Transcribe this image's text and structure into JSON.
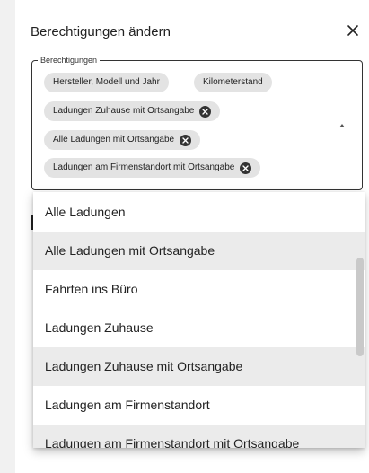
{
  "dialog": {
    "title": "Berechtigungen ändern",
    "close_icon": "close-icon"
  },
  "field": {
    "legend": "Berechtigungen",
    "chips": [
      {
        "label": "Hersteller, Modell und Jahr",
        "removable": false
      },
      {
        "label": "Kilometerstand",
        "removable": false
      },
      {
        "label": "Ladungen Zuhause mit Ortsangabe",
        "removable": true
      },
      {
        "label": "Alle Ladungen mit Ortsangabe",
        "removable": true
      },
      {
        "label": "Ladungen am Firmenstandort mit Ortsangabe",
        "removable": true
      }
    ]
  },
  "menu": {
    "items": [
      {
        "label": "Alle Ladungen",
        "selected": false
      },
      {
        "label": "Alle Ladungen mit Ortsangabe",
        "selected": true
      },
      {
        "label": "Fahrten ins Büro",
        "selected": false
      },
      {
        "label": "Ladungen Zuhause",
        "selected": false
      },
      {
        "label": "Ladungen Zuhause mit Ortsangabe",
        "selected": true
      },
      {
        "label": "Ladungen am Firmenstandort",
        "selected": false
      },
      {
        "label": "Ladungen am Firmenstandort mit Ortsangabe",
        "selected": true
      }
    ]
  },
  "colors": {
    "background": "#f1f1f1",
    "chip": "#e3e3e3",
    "selected_item": "#ebebeb",
    "text": "#222222"
  }
}
